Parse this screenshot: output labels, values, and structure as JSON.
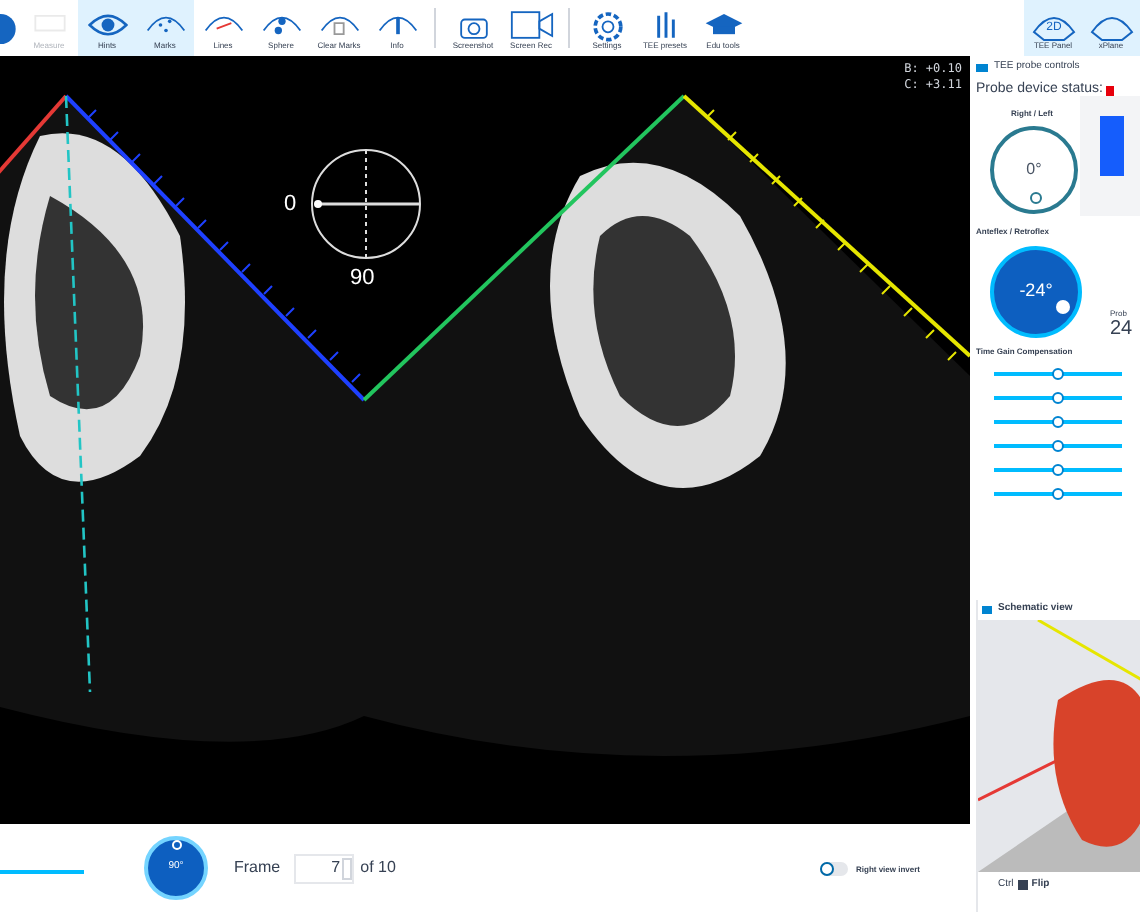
{
  "toolbar": [
    {
      "kind": "edge",
      "selected": false,
      "disabled": false
    },
    {
      "kind": "measure",
      "label": "Measure",
      "selected": false,
      "disabled": true
    },
    {
      "kind": "hints",
      "label": "Hints",
      "selected": true,
      "disabled": false
    },
    {
      "kind": "marks",
      "label": "Marks",
      "selected": true,
      "disabled": false
    },
    {
      "kind": "lines",
      "label": "Lines",
      "selected": false,
      "disabled": false
    },
    {
      "kind": "sphere",
      "label": "Sphere",
      "selected": false,
      "disabled": false
    },
    {
      "kind": "clear",
      "label": "Clear Marks",
      "selected": false,
      "disabled": false
    },
    {
      "kind": "info",
      "label": "Info",
      "selected": false,
      "disabled": false
    },
    {
      "kind": "sep"
    },
    {
      "kind": "camera",
      "label": "Screenshot",
      "selected": false,
      "disabled": false
    },
    {
      "kind": "video",
      "label": "Screen Rec",
      "selected": false,
      "disabled": false
    },
    {
      "kind": "sep"
    },
    {
      "kind": "settings",
      "label": "Settings",
      "selected": false,
      "disabled": false
    },
    {
      "kind": "presets",
      "label": "TEE presets",
      "selected": false,
      "disabled": false
    },
    {
      "kind": "edu",
      "label": "Edu tools",
      "selected": false,
      "disabled": false
    }
  ],
  "view_tabs": [
    {
      "label": "TEE Panel",
      "icon_text": "2D",
      "selected": true
    },
    {
      "label": "xPlane",
      "selected": true
    }
  ],
  "viewer": {
    "orientation": {
      "left_label": "0",
      "bottom_label": "90"
    },
    "readouts": [
      "B: +0.10",
      "C: +3.11"
    ]
  },
  "panel": {
    "title": "TEE probe controls",
    "status_label": "Probe device status:",
    "right_left": {
      "label": "Right / Left",
      "value": "0°"
    },
    "anteflex": {
      "label": "Anteflex / Retroflex",
      "value": "-24°"
    },
    "probe_label": "Prob",
    "probe_value": "24",
    "tgc": {
      "label": "Time Gain Compensation",
      "sliders": [
        {
          "level": 0.5
        },
        {
          "level": 0.5
        },
        {
          "level": 0.5
        },
        {
          "level": 0.5
        },
        {
          "level": 0.5
        },
        {
          "level": 0.5
        }
      ]
    }
  },
  "schematic": {
    "title": "Schematic view",
    "ctrl_label": "Ctrl",
    "flip_label": "Flip",
    "flip_checked": true
  },
  "bottom": {
    "rotation_value": "90°",
    "frame_label": "Frame",
    "frame_value": "7",
    "frame_total": "of 10",
    "invert_label": "Right view invert",
    "invert_on": false
  }
}
